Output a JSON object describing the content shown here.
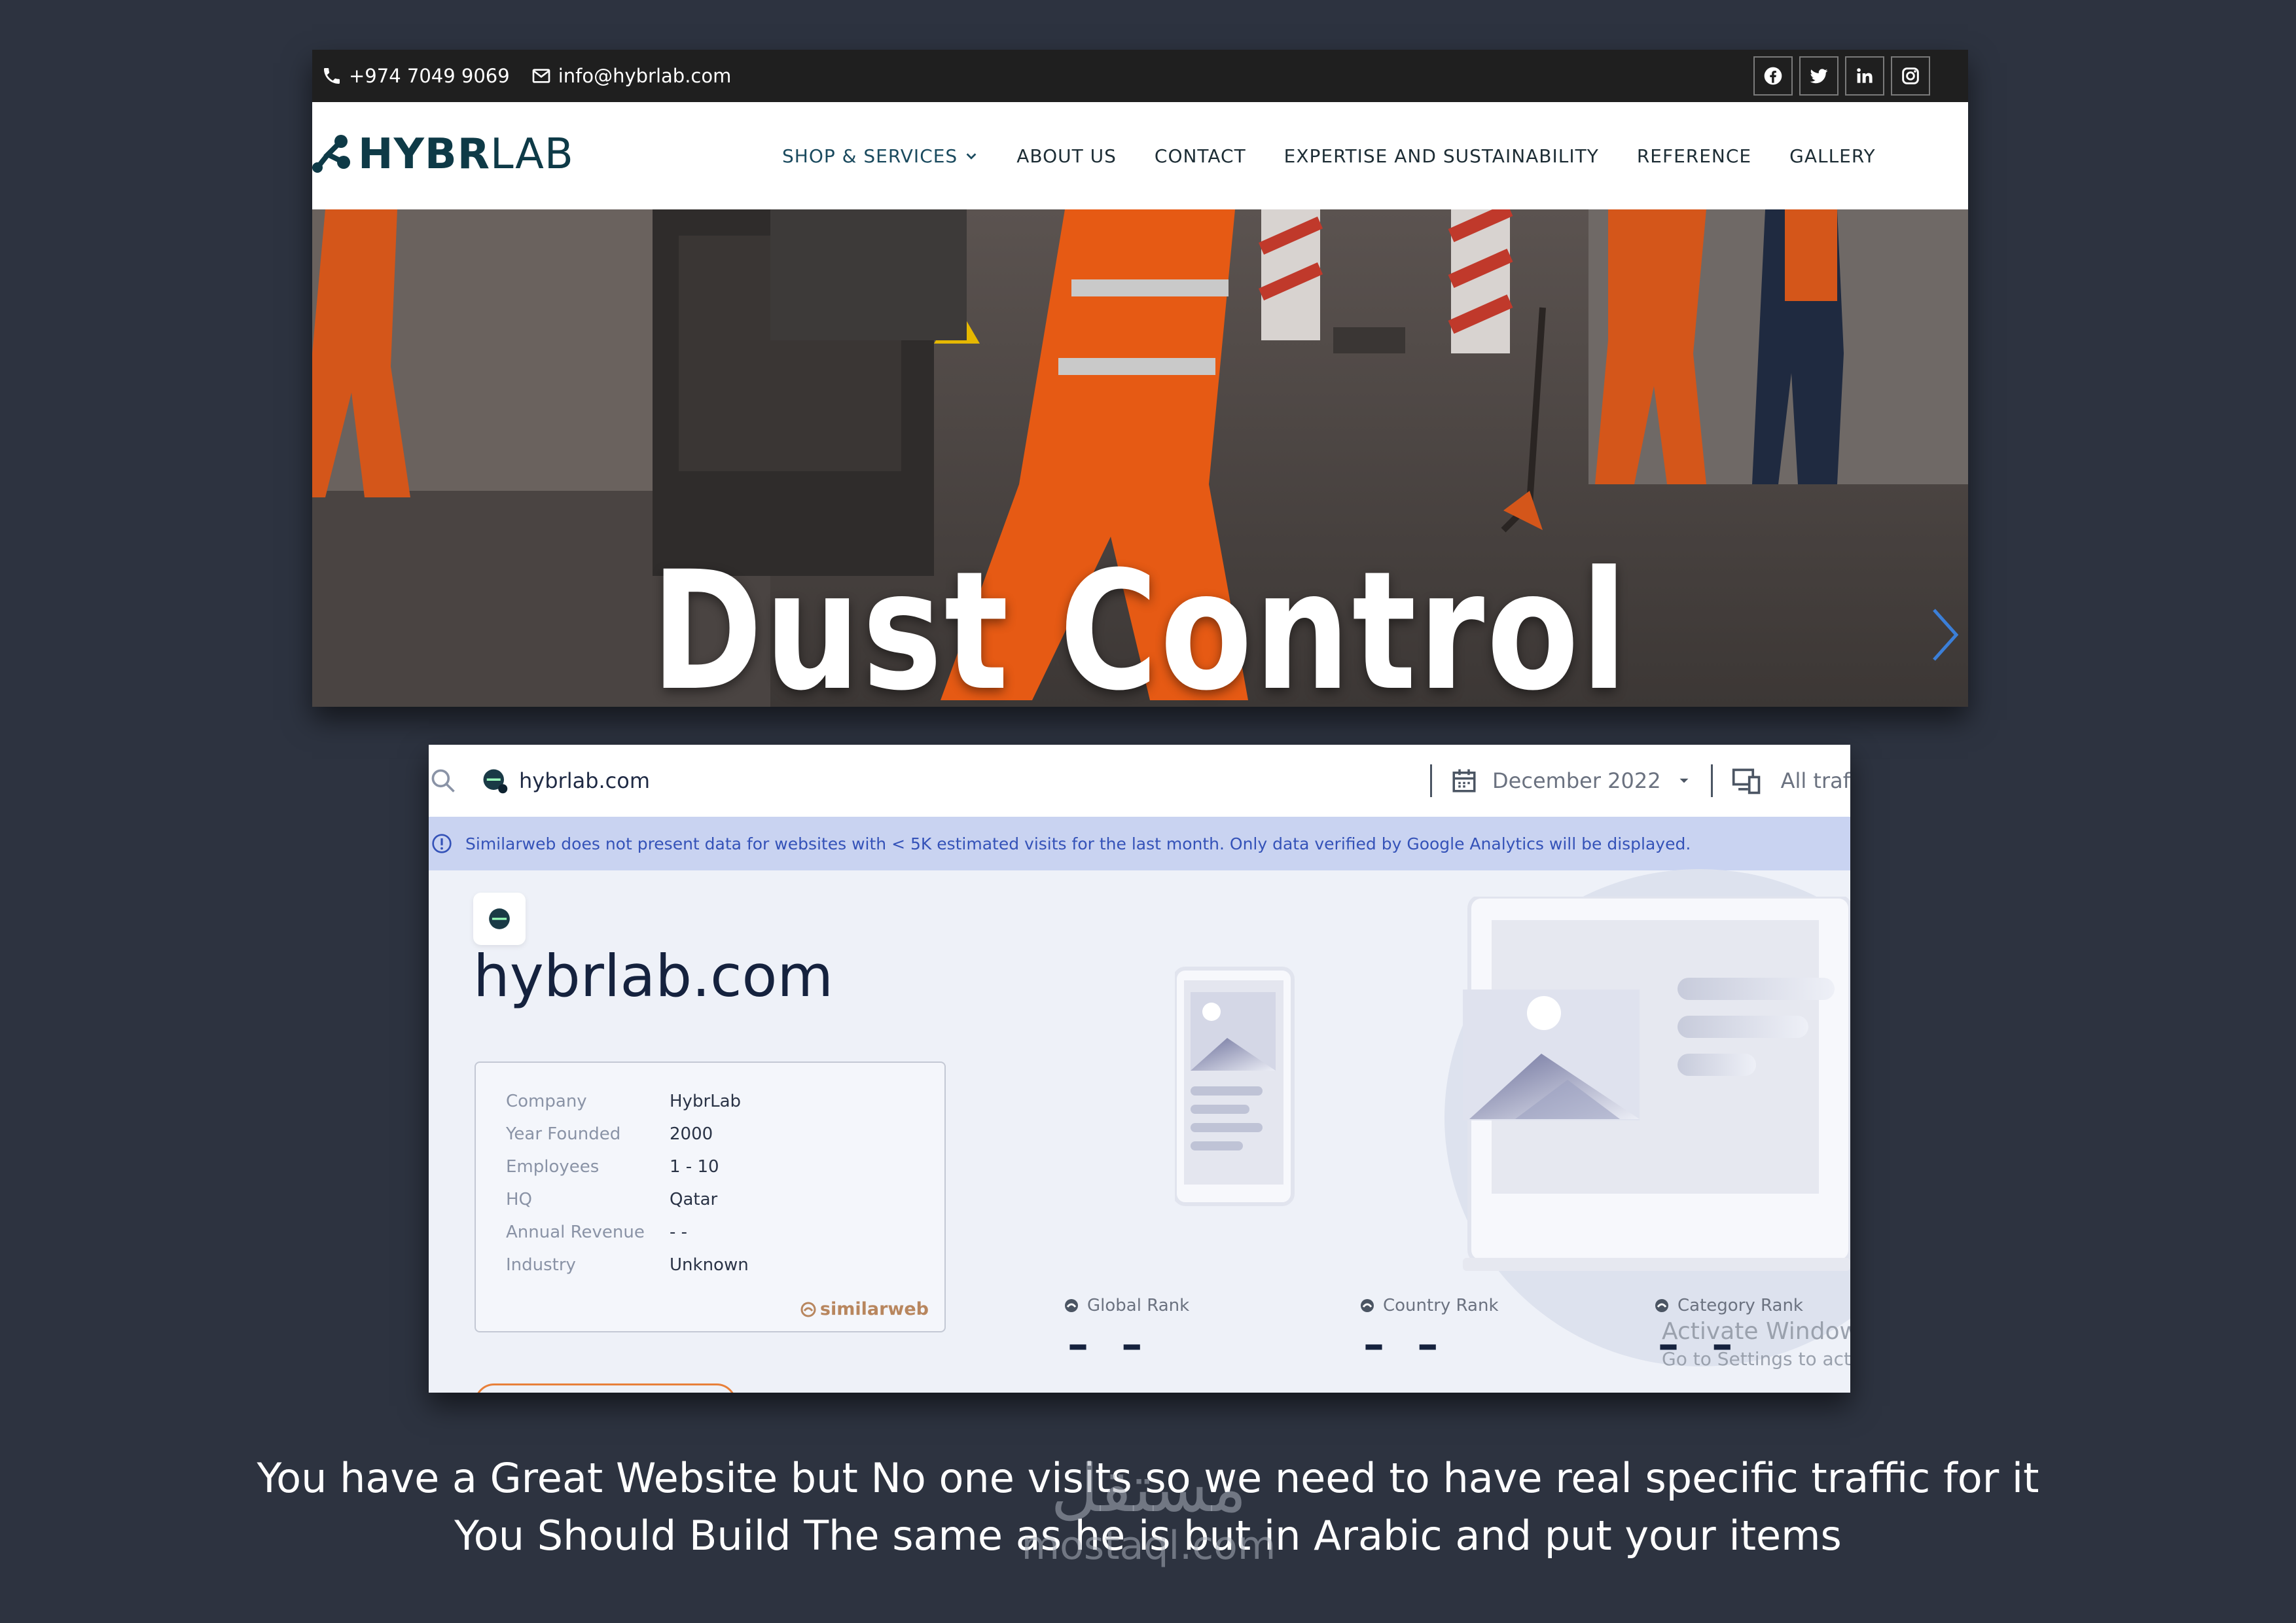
{
  "site": {
    "topbar": {
      "phone": "+974 7049 9069",
      "email": "info@hybrlab.com"
    },
    "logo": {
      "part1": "HYBR",
      "part2": "LAB"
    },
    "nav": [
      {
        "label": "SHOP & SERVICES",
        "dropdown": true
      },
      {
        "label": "ABOUT US"
      },
      {
        "label": "CONTACT"
      },
      {
        "label": "EXPERTISE AND SUSTAINABILITY"
      },
      {
        "label": "REFERENCE"
      },
      {
        "label": "GALLERY"
      }
    ],
    "hero": {
      "title": "Dust Control"
    },
    "colors": {
      "brand": "#0e3a47",
      "topbar": "#1f1f1f",
      "arrow": "#3b7fd8"
    }
  },
  "similarweb": {
    "search": {
      "domain": "hybrlab.com"
    },
    "date": "December 2022",
    "traffic": "All traf",
    "alert": "Similarweb does not present data for websites with < 5K estimated visits for the last month. Only data verified by Google Analytics will be displayed.",
    "title": "hybrlab.com",
    "card": {
      "rows": [
        {
          "key": "Company",
          "value": "HybrLab"
        },
        {
          "key": "Year Founded",
          "value": "2000"
        },
        {
          "key": "Employees",
          "value": "1 - 10"
        },
        {
          "key": "HQ",
          "value": "Qatar"
        },
        {
          "key": "Annual Revenue",
          "value": "- -"
        },
        {
          "key": "Industry",
          "value": "Unknown"
        }
      ],
      "brand": "similarweb"
    },
    "ranks": [
      {
        "label": "Global Rank",
        "value": "– –"
      },
      {
        "label": "Country Rank",
        "value": "– –"
      },
      {
        "label": "Category Rank",
        "value": "– –"
      }
    ],
    "windows_notice": {
      "line1": "Activate Window",
      "line2": "Go to Settings to activ"
    },
    "colors": {
      "alert_bg": "#c9d3f1",
      "alert_text": "#3452b8",
      "title": "#15223e"
    }
  },
  "caption": {
    "line1": "You have a Great Website but No one visits so we need to have real specific traffic for it",
    "line2": "You Should Build The same as he is but in Arabic and put your items"
  },
  "watermark": {
    "arabic": "مستقل",
    "latin": "mostaql.com"
  }
}
